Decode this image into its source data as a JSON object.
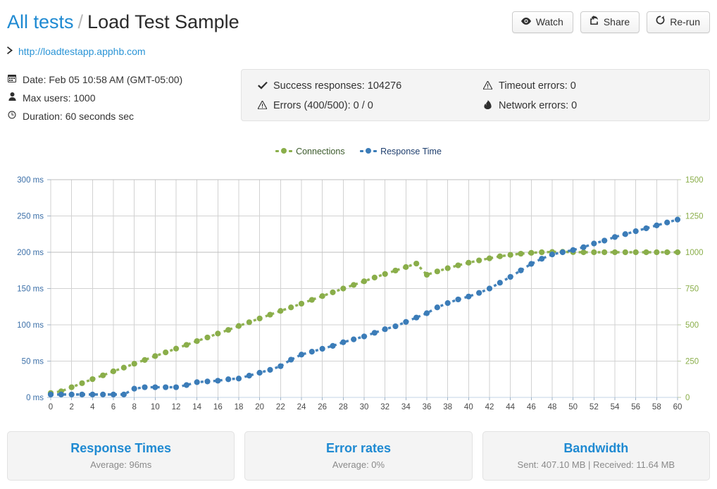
{
  "header": {
    "breadcrumb_root": "All tests",
    "breadcrumb_separator": "/",
    "breadcrumb_current": "Load Test Sample",
    "url": "http://loadtestapp.apphb.com",
    "chevron_icon": "chevron-right-icon",
    "buttons": [
      {
        "label": "Watch",
        "icon": "eye-icon",
        "glyph": "◉"
      },
      {
        "label": "Share",
        "icon": "share-icon",
        "glyph": "↪"
      },
      {
        "label": "Re-run",
        "icon": "refresh-icon",
        "glyph": "↻"
      }
    ]
  },
  "meta": [
    {
      "icon": "calendar-icon",
      "glyph": "☷",
      "text": "Date: Feb 05 10:58 AM (GMT-05:00)"
    },
    {
      "icon": "user-icon",
      "glyph": "♟",
      "text": "Max users: 1000"
    },
    {
      "icon": "clock-icon",
      "glyph": "◴",
      "text": "Duration: 60 seconds sec"
    }
  ],
  "stats": [
    {
      "icon": "check-icon",
      "glyph": "✔",
      "text": "Success responses: 104276"
    },
    {
      "icon": "warning-icon",
      "glyph": "⚠",
      "text": "Timeout errors: 0"
    },
    {
      "icon": "warning-icon",
      "glyph": "⚠",
      "text": "Errors (400/500): 0 / 0"
    },
    {
      "icon": "fire-icon",
      "glyph": "♨",
      "text": "Network errors: 0"
    }
  ],
  "cards": [
    {
      "title": "Response Times",
      "subtitle": "Average: 96ms"
    },
    {
      "title": "Error rates",
      "subtitle": "Average: 0%"
    },
    {
      "title": "Bandwidth",
      "subtitle": "Sent: 407.10 MB | Received: 11.64 MB"
    }
  ],
  "colors": {
    "connections": "#8aae4a",
    "response_time": "#3b7cb8",
    "accent": "#1f8ad2",
    "grid": "#d2d2d2",
    "axis_left_text": "#3b6fa8",
    "axis_right_text": "#8aae4a"
  },
  "chart_data": {
    "type": "line",
    "title": "",
    "xlabel": "",
    "legend": [
      "Connections",
      "Response Time"
    ],
    "legend_position": "top-center",
    "grid": true,
    "x": [
      0,
      1,
      2,
      3,
      4,
      5,
      6,
      7,
      8,
      9,
      10,
      11,
      12,
      13,
      14,
      15,
      16,
      17,
      18,
      19,
      20,
      21,
      22,
      23,
      24,
      25,
      26,
      27,
      28,
      29,
      30,
      31,
      32,
      33,
      34,
      35,
      36,
      37,
      38,
      39,
      40,
      41,
      42,
      43,
      44,
      45,
      46,
      47,
      48,
      49,
      50,
      51,
      52,
      53,
      54,
      55,
      56,
      57,
      58,
      59,
      60
    ],
    "x_ticks": [
      0,
      2,
      4,
      6,
      8,
      10,
      12,
      14,
      16,
      18,
      20,
      22,
      24,
      26,
      28,
      30,
      32,
      34,
      36,
      38,
      40,
      42,
      44,
      46,
      48,
      50,
      52,
      54,
      56,
      58,
      60
    ],
    "xlim": [
      0,
      60
    ],
    "axes": {
      "left": {
        "label_suffix": " ms",
        "ticks": [
          0,
          50,
          100,
          150,
          200,
          250,
          300
        ],
        "tick_labels": [
          "0 ms",
          "50 ms",
          "100 ms",
          "150 ms",
          "200 ms",
          "250 ms",
          "300 ms"
        ],
        "ylim": [
          0,
          300
        ],
        "color": "#3b6fa8"
      },
      "right": {
        "ticks": [
          0,
          250,
          500,
          750,
          1000,
          1250,
          1500
        ],
        "tick_labels": [
          "0",
          "250",
          "500",
          "750",
          "1000",
          "1250",
          "1500"
        ],
        "ylim": [
          0,
          1500
        ],
        "color": "#8aae4a"
      }
    },
    "series": [
      {
        "name": "Connections",
        "axis": "right",
        "color": "#8aae4a",
        "style": "dashed-markers",
        "values": [
          30,
          42,
          70,
          98,
          126,
          152,
          180,
          205,
          232,
          258,
          285,
          310,
          336,
          362,
          388,
          413,
          440,
          465,
          492,
          518,
          544,
          570,
          596,
          620,
          646,
          672,
          698,
          724,
          750,
          775,
          800,
          826,
          850,
          874,
          898,
          922,
          845,
          868,
          890,
          910,
          928,
          944,
          958,
          972,
          982,
          990,
          996,
          1000,
          1002,
          1003,
          1001,
          1000,
          1000,
          1000,
          1000,
          1000,
          1000,
          1000,
          1000,
          1000,
          1000
        ]
      },
      {
        "name": "Response Time",
        "axis": "left",
        "color": "#3b7cb8",
        "style": "dashed-markers",
        "values": [
          4,
          4,
          4,
          4,
          4,
          4,
          4,
          4,
          12,
          14,
          14,
          14,
          14,
          17,
          21,
          22,
          23,
          25,
          26,
          30,
          34,
          38,
          43,
          52,
          59,
          63,
          67,
          71,
          76,
          80,
          84,
          89,
          94,
          98,
          104,
          110,
          116,
          124,
          130,
          135,
          139,
          144,
          150,
          158,
          166,
          175,
          184,
          191,
          197,
          200,
          203,
          207,
          212,
          216,
          221,
          225,
          229,
          233,
          237,
          241,
          245
        ]
      }
    ]
  }
}
